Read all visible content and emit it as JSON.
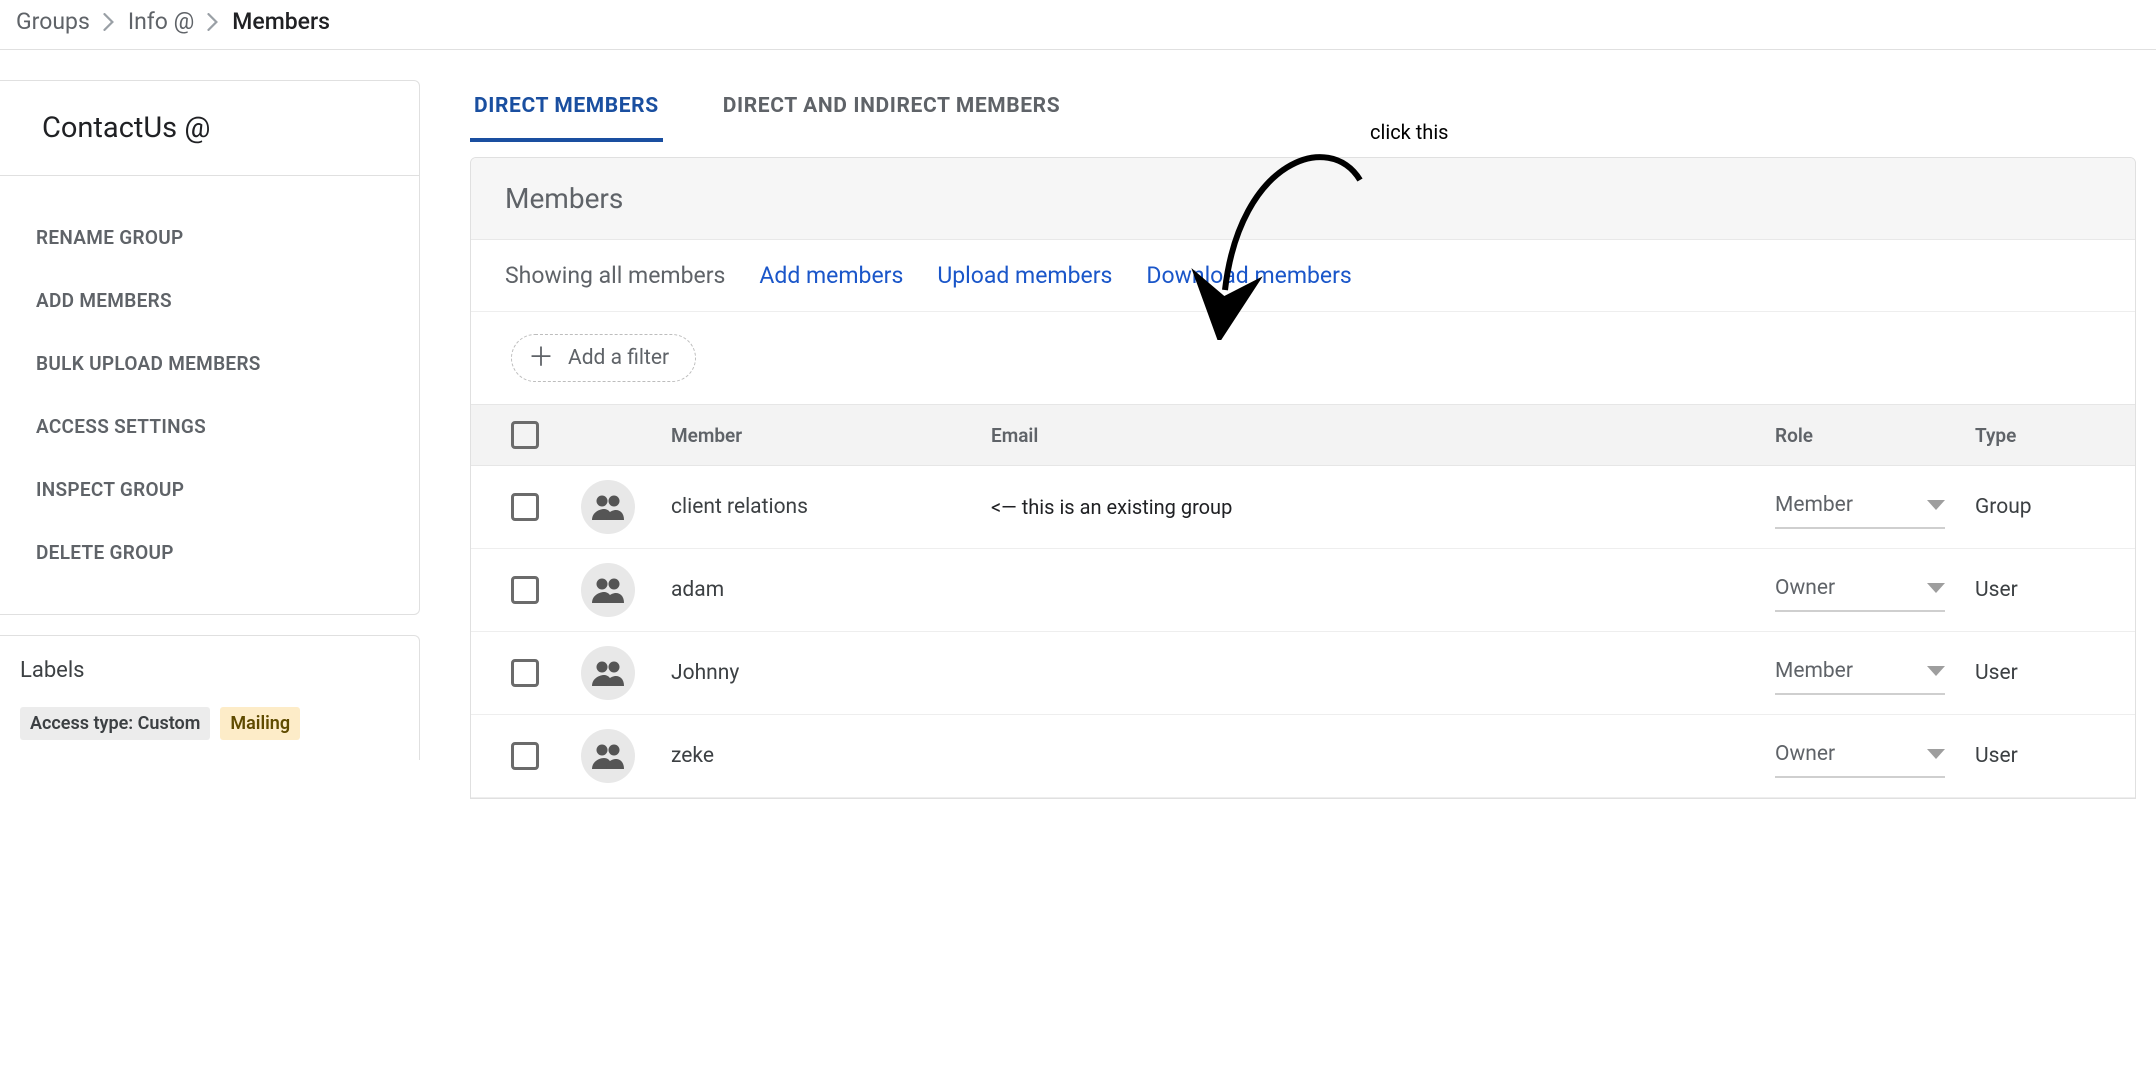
{
  "breadcrumb": {
    "root": "Groups",
    "mid": "Info @",
    "current": "Members"
  },
  "sidebar": {
    "group_title": "ContactUs @",
    "actions": [
      "RENAME GROUP",
      "ADD MEMBERS",
      "BULK UPLOAD MEMBERS",
      "ACCESS SETTINGS",
      "INSPECT GROUP",
      "DELETE GROUP"
    ],
    "labels_title": "Labels",
    "label_access": "Access type: Custom",
    "label_mailing": "Mailing"
  },
  "tabs": {
    "direct": "DIRECT MEMBERS",
    "indirect": "DIRECT AND INDIRECT MEMBERS"
  },
  "panel": {
    "title": "Members",
    "showing": "Showing all members",
    "add": "Add members",
    "upload": "Upload members",
    "download": "Download members",
    "filter_label": "Add a filter"
  },
  "columns": {
    "member": "Member",
    "email": "Email",
    "role": "Role",
    "type": "Type"
  },
  "rows": [
    {
      "member": "client relations",
      "email_note": "<— this is an existing group",
      "role": "Member",
      "type": "Group"
    },
    {
      "member": "adam",
      "email_note": "",
      "role": "Owner",
      "type": "User"
    },
    {
      "member": "Johnny",
      "email_note": "",
      "role": "Member",
      "type": "User"
    },
    {
      "member": "zeke",
      "email_note": "",
      "role": "Owner",
      "type": "User"
    }
  ],
  "annotation": {
    "text": "click this"
  }
}
